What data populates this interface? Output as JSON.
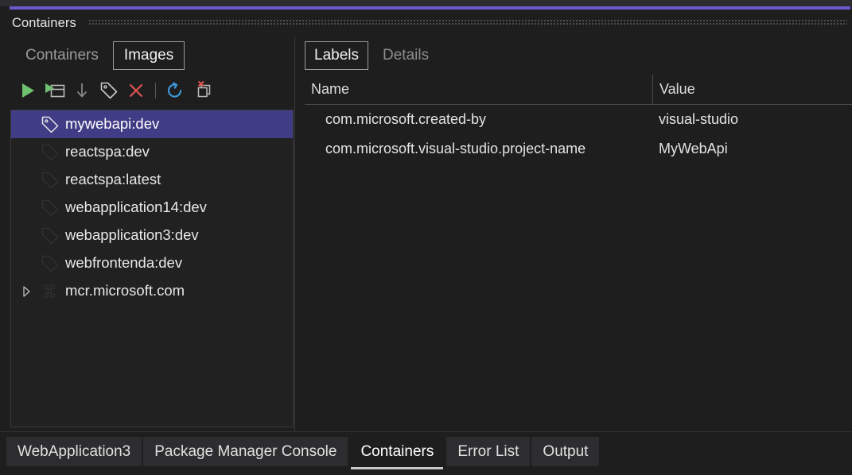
{
  "window": {
    "title": "Containers",
    "accent_color": "#6a5acd",
    "drag_handle_icon": "drag-dots-icon"
  },
  "left_pane": {
    "tabs": [
      {
        "label": "Containers",
        "selected": false
      },
      {
        "label": "Images",
        "selected": true
      }
    ],
    "toolbar": [
      {
        "name": "run-button",
        "icon": "play-icon",
        "enabled": true
      },
      {
        "name": "run-interactive-button",
        "icon": "run-window-icon",
        "enabled": true
      },
      {
        "name": "pull-button",
        "icon": "download-arrow-icon",
        "enabled": false
      },
      {
        "name": "tag-button",
        "icon": "tag-icon",
        "enabled": true
      },
      {
        "name": "remove-button",
        "icon": "close-x-icon",
        "enabled": true
      },
      {
        "name": "toolbar-separator",
        "icon": "separator",
        "enabled": false
      },
      {
        "name": "refresh-button",
        "icon": "refresh-icon",
        "enabled": true
      },
      {
        "name": "prune-button",
        "icon": "prune-images-icon",
        "enabled": true
      }
    ],
    "tree": [
      {
        "label": "mywebapi:dev",
        "icon": "tag-icon",
        "selected": true,
        "expandable": false
      },
      {
        "label": "reactspa:dev",
        "icon": "tag-icon",
        "selected": false,
        "expandable": false
      },
      {
        "label": "reactspa:latest",
        "icon": "tag-icon",
        "selected": false,
        "expandable": false
      },
      {
        "label": "webapplication14:dev",
        "icon": "tag-icon",
        "selected": false,
        "expandable": false
      },
      {
        "label": "webapplication3:dev",
        "icon": "tag-icon",
        "selected": false,
        "expandable": false
      },
      {
        "label": "webfrontenda:dev",
        "icon": "tag-icon",
        "selected": false,
        "expandable": false
      },
      {
        "label": "mcr.microsoft.com",
        "icon": "registry-icon",
        "selected": false,
        "expandable": true
      }
    ]
  },
  "right_pane": {
    "tabs": [
      {
        "label": "Labels",
        "selected": true
      },
      {
        "label": "Details",
        "selected": false
      }
    ],
    "columns": {
      "name": "Name",
      "value": "Value"
    },
    "rows": [
      {
        "name": "com.microsoft.created-by",
        "value": "visual-studio"
      },
      {
        "name": "com.microsoft.visual-studio.project-name",
        "value": "MyWebApi"
      }
    ]
  },
  "bottom_tabs": [
    {
      "label": "WebApplication3",
      "active": false
    },
    {
      "label": "Package Manager Console",
      "active": false
    },
    {
      "label": "Containers",
      "active": true
    },
    {
      "label": "Error List",
      "active": false
    },
    {
      "label": "Output",
      "active": false
    }
  ],
  "colors": {
    "background": "#1e1e1e",
    "panel": "#212121",
    "selection": "#413c86",
    "accent": "#6a5acd",
    "play_green": "#6fc26f",
    "delete_red": "#e05252",
    "refresh_blue": "#3e9be0",
    "text": "#e6e6e6",
    "text_dim": "#9a9a9a"
  }
}
